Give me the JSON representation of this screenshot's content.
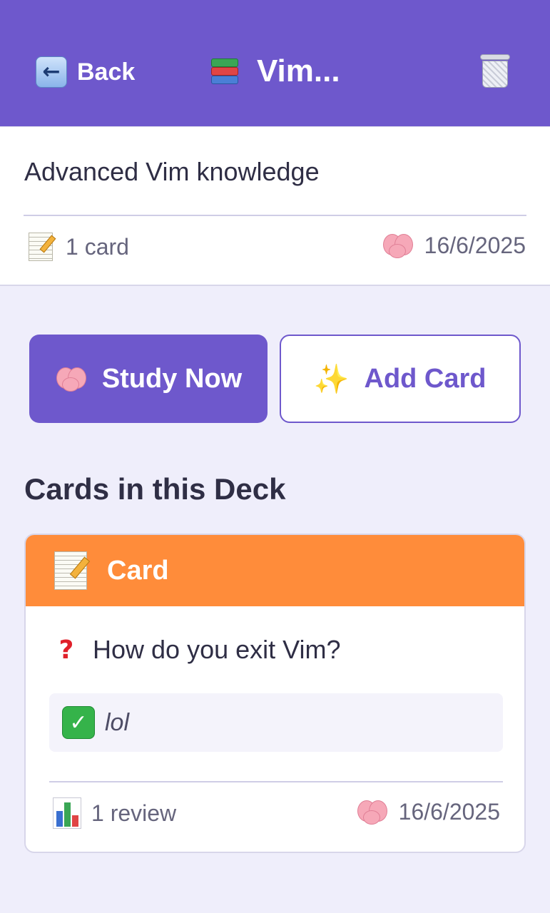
{
  "header": {
    "back_label": "Back",
    "title": "Vim...",
    "background_color": "#6e58cc"
  },
  "icons": {
    "back": "back-arrow-icon",
    "deck": "books-icon",
    "delete": "trash-icon",
    "cards": "memo-icon",
    "study": "brain-icon",
    "add": "sparkles-icon",
    "question": "question-mark-icon",
    "answer": "check-mark-icon",
    "reviews": "bar-chart-icon"
  },
  "deck": {
    "description": "Advanced Vim knowledge",
    "card_count": "1 card",
    "due_date": "16/6/2025"
  },
  "actions": {
    "study_label": "Study Now",
    "add_label": "Add Card"
  },
  "cards_section": {
    "title": "Cards in this Deck",
    "cards": [
      {
        "header_label": "Card",
        "header_color": "#ff8c3a",
        "question": "How do you exit Vim?",
        "answer": "lol",
        "reviews": "1 review",
        "due_date": "16/6/2025"
      }
    ]
  }
}
